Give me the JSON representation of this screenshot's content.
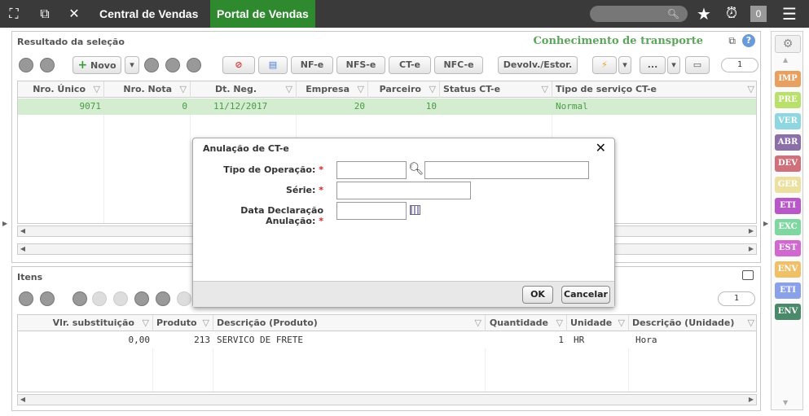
{
  "topbar": {
    "tabs": [
      {
        "label": "Central de Vendas"
      },
      {
        "label": "Portal de Vendas"
      }
    ],
    "badge": "0"
  },
  "main": {
    "title": "Resultado da seleção",
    "right_title": "Conhecimento de transporte",
    "toolbar": {
      "novo": "Novo",
      "nfe": "NF-e",
      "nfse": "NFS-e",
      "cte": "CT-e",
      "nfce": "NFC-e",
      "devolv": "Devolv./Estor.",
      "more": "...",
      "page": "1"
    },
    "columns": [
      "Nro. Único",
      "Nro. Nota",
      "Dt. Neg.",
      "Empresa",
      "Parceiro",
      "Status CT-e",
      "Tipo de serviço CT-e"
    ],
    "rows": [
      {
        "nro_unico": "9071",
        "nro_nota": "0",
        "dt_neg": "11/12/2017",
        "empresa": "20",
        "parceiro": "10",
        "status": "",
        "tipo": "Normal"
      }
    ]
  },
  "items": {
    "title": "Itens",
    "page": "1",
    "columns": [
      "Vlr. substituição",
      "Produto",
      "Descrição (Produto)",
      "Quantidade",
      "Unidade",
      "Descrição (Unidade)"
    ],
    "rows": [
      {
        "vlr": "0,00",
        "produto": "213",
        "descricao": "SERVICO DE FRETE",
        "quantidade": "1",
        "unidade": "HR",
        "desc_unidade": "Hora"
      }
    ]
  },
  "sidebar": {
    "buttons": [
      {
        "label": "IMP",
        "color": "#e8a060"
      },
      {
        "label": "PRE",
        "color": "#b8e06a"
      },
      {
        "label": "VER",
        "color": "#8ed6e0"
      },
      {
        "label": "ABR",
        "color": "#8b6fa8"
      },
      {
        "label": "DEV",
        "color": "#d0707a"
      },
      {
        "label": "GER",
        "color": "#ece0a0"
      },
      {
        "label": "ETI",
        "color": "#b858c8"
      },
      {
        "label": "EXC",
        "color": "#7ed6a0"
      },
      {
        "label": "EST",
        "color": "#d068d0"
      },
      {
        "label": "ENV",
        "color": "#f0c068"
      },
      {
        "label": "ETI",
        "color": "#8aa0e8"
      },
      {
        "label": "ENV",
        "color": "#4a8a6a"
      }
    ]
  },
  "dialog": {
    "title": "Anulação de CT-e",
    "fields": {
      "tipo_operacao": "Tipo de Operação:",
      "serie": "Série:",
      "data_declaracao": "Data Declaração Anulação:"
    },
    "required_mark": "*",
    "ok": "OK",
    "cancel": "Cancelar"
  }
}
